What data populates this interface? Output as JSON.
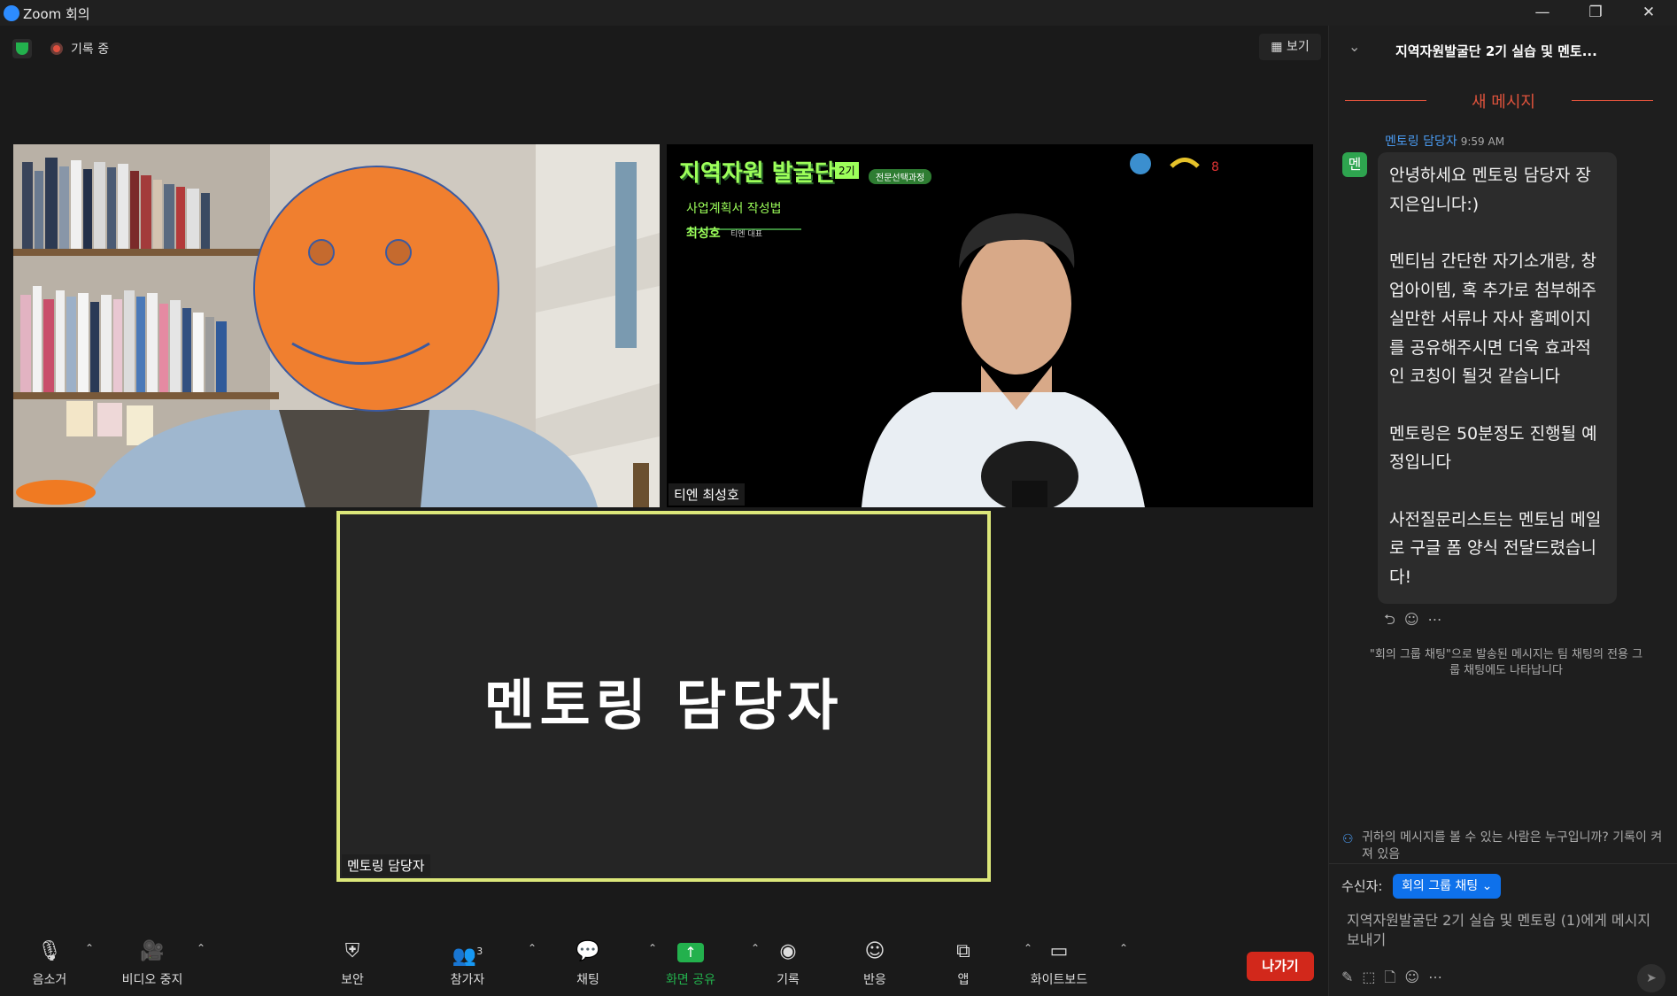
{
  "titlebar": {
    "title": "Zoom 회의",
    "minimize": "—",
    "restore": "❐",
    "close": "✕"
  },
  "meeting": {
    "recording_label": "기록 중",
    "view_button": "보기",
    "tiles": {
      "top_left_name": "",
      "top_right_name": "티엔 최성호",
      "active_name": "멘토링 담당자",
      "active_name_large": "멘토링 담당자"
    },
    "slide": {
      "title": "지역자원 발굴단",
      "badge": "2기",
      "tag": "전문선택과정",
      "subtitle": "사업계획서 작성법",
      "presenter": "최성호",
      "presenter_role": "티엔 대표"
    }
  },
  "toolbar": {
    "mute": "음소거",
    "video": "비디오 중지",
    "security": "보안",
    "participants": "참가자",
    "participants_count": "3",
    "chat": "채팅",
    "share": "화면 공유",
    "record": "기록",
    "reactions": "반응",
    "apps": "앱",
    "whiteboard": "화이트보드",
    "leave": "나가기"
  },
  "chat": {
    "title": "지역자원발굴단 2기 실습 및 멘토...",
    "new_messages": "새 메시지",
    "message": {
      "sender": "멘토링 담당자",
      "time": "9:59 AM",
      "avatar": "멘",
      "paragraphs": [
        "안녕하세요 멘토링 담당자 장지은입니다:)",
        "멘티님 간단한 자기소개랑, 창업아이템, 혹 추가로 첨부해주실만한 서류나 자사 홈페이지를 공유해주시면 더욱 효과적인 코칭이 될것 같습니다",
        "멘토링은 50분정도 진행될 예정입니다",
        "사전질문리스트는 멘토님 메일로 구글 폼 양식 전달드렸습니다!"
      ]
    },
    "notice": "\"회의 그룹 채팅\"으로 발송된 메시지는 팀 채팅의 전용 그룹 채팅에도 나타납니다",
    "privacy": "귀하의 메시지를 볼 수 있는 사람은 누구입니까? 기록이 켜져 있음",
    "to_label": "수신자:",
    "to_value": "회의 그룹 채팅",
    "placeholder": "지역자원발굴단 2기 실습 및 멘토링 (1)에게 메시지 보내기"
  },
  "colors": {
    "accent": "#0e71eb",
    "leave": "#d2281b",
    "share": "#23b14d",
    "active_border": "#dce77a",
    "new_msg": "#e0533c"
  }
}
